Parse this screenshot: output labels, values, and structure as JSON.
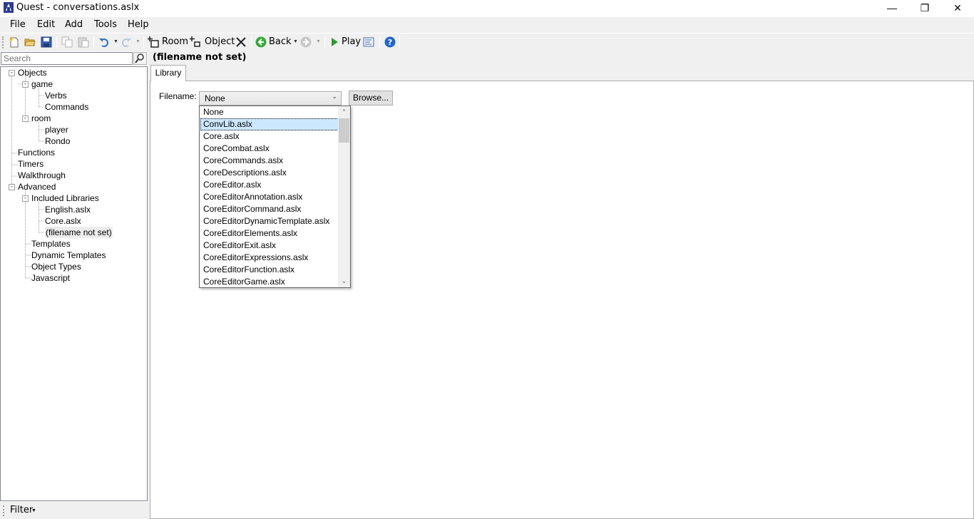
{
  "window": {
    "title": "Quest - conversations.aslx",
    "minimize": "—",
    "restore": "❐",
    "close": "✕"
  },
  "menu": {
    "items": [
      {
        "label": "File"
      },
      {
        "label": "Edit"
      },
      {
        "label": "Add"
      },
      {
        "label": "Tools"
      },
      {
        "label": "Help"
      }
    ]
  },
  "toolbar": {
    "room_label": "Room",
    "object_label": "Object",
    "back_label": "Back",
    "play_label": "Play"
  },
  "search": {
    "placeholder": "Search"
  },
  "tree": {
    "objects": "Objects",
    "game": "game",
    "verbs": "Verbs",
    "commands": "Commands",
    "room": "room",
    "player": "player",
    "rondo": "Rondo",
    "functions": "Functions",
    "timers": "Timers",
    "walkthrough": "Walkthrough",
    "advanced": "Advanced",
    "included_libraries": "Included Libraries",
    "english": "English.aslx",
    "core": "Core.aslx",
    "filename_not_set": "(filename not set)",
    "templates": "Templates",
    "dynamic_templates": "Dynamic Templates",
    "object_types": "Object Types",
    "javascript": "Javascript"
  },
  "filter": {
    "label": "Filter"
  },
  "editor": {
    "title": "(filename not set)",
    "tab_label": "Library",
    "filename_label": "Filename:",
    "combo_value": "None",
    "browse_label": "Browse...",
    "options": [
      "None",
      "ConvLib.aslx",
      "Core.aslx",
      "CoreCombat.aslx",
      "CoreCommands.aslx",
      "CoreDescriptions.aslx",
      "CoreEditor.aslx",
      "CoreEditorAnnotation.aslx",
      "CoreEditorCommand.aslx",
      "CoreEditorDynamicTemplate.aslx",
      "CoreEditorElements.aslx",
      "CoreEditorExit.aslx",
      "CoreEditorExpressions.aslx",
      "CoreEditorFunction.aslx",
      "CoreEditorGame.aslx"
    ],
    "highlighted_index": 1
  }
}
